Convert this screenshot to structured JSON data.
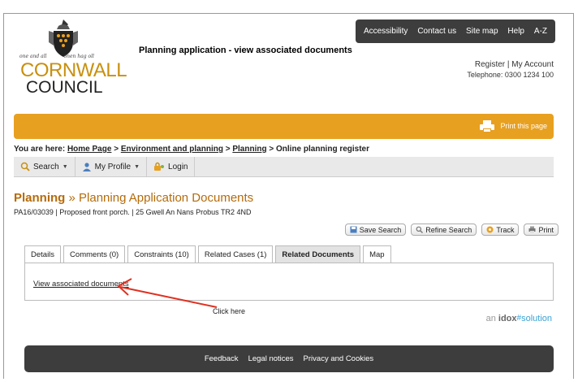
{
  "topnav": [
    "Accessibility",
    "Contact us",
    "Site map",
    "Help",
    "A-Z"
  ],
  "logo": {
    "motto_left": "one and all",
    "motto_right": "onen hag oll",
    "line1": "CORNWALL",
    "line2": "COUNCIL"
  },
  "headline": "Planning application - view associated documents",
  "account": {
    "register": "Register",
    "separator": "|",
    "my_account": "My Account",
    "telephone": "Telephone: 0300 1234 100"
  },
  "banner": {
    "print_label": "Print this page"
  },
  "breadcrumb": {
    "prefix": "You are here:",
    "items": [
      "Home Page",
      "Environment and planning",
      "Planning",
      "Online planning register"
    ],
    "separator": ">"
  },
  "toolbar": {
    "search": "Search",
    "profile": "My Profile",
    "login": "Login"
  },
  "page_title": {
    "section": "Planning",
    "separator": "»",
    "title": "Planning Application Documents"
  },
  "subtitle": "PA16/03039 | Proposed front porch. | 25 Gwell An Nans Probus TR2 4ND",
  "actions": [
    "Save Search",
    "Refine Search",
    "Track",
    "Print"
  ],
  "tabs": [
    "Details",
    "Comments (0)",
    "Constraints (10)",
    "Related Cases (1)",
    "Related Documents",
    "Map"
  ],
  "active_tab": "Related Documents",
  "panel_link": "View associated documents",
  "annotation": "Click here",
  "idox": {
    "an": "an",
    "brand": "idox",
    "solution": "solution"
  },
  "footer": [
    "Feedback",
    "Legal notices",
    "Privacy and Cookies"
  ],
  "colors": {
    "accent": "#e8a020",
    "title": "#b56b0a",
    "dark": "#3d3d3d",
    "arrow": "#e03020"
  }
}
